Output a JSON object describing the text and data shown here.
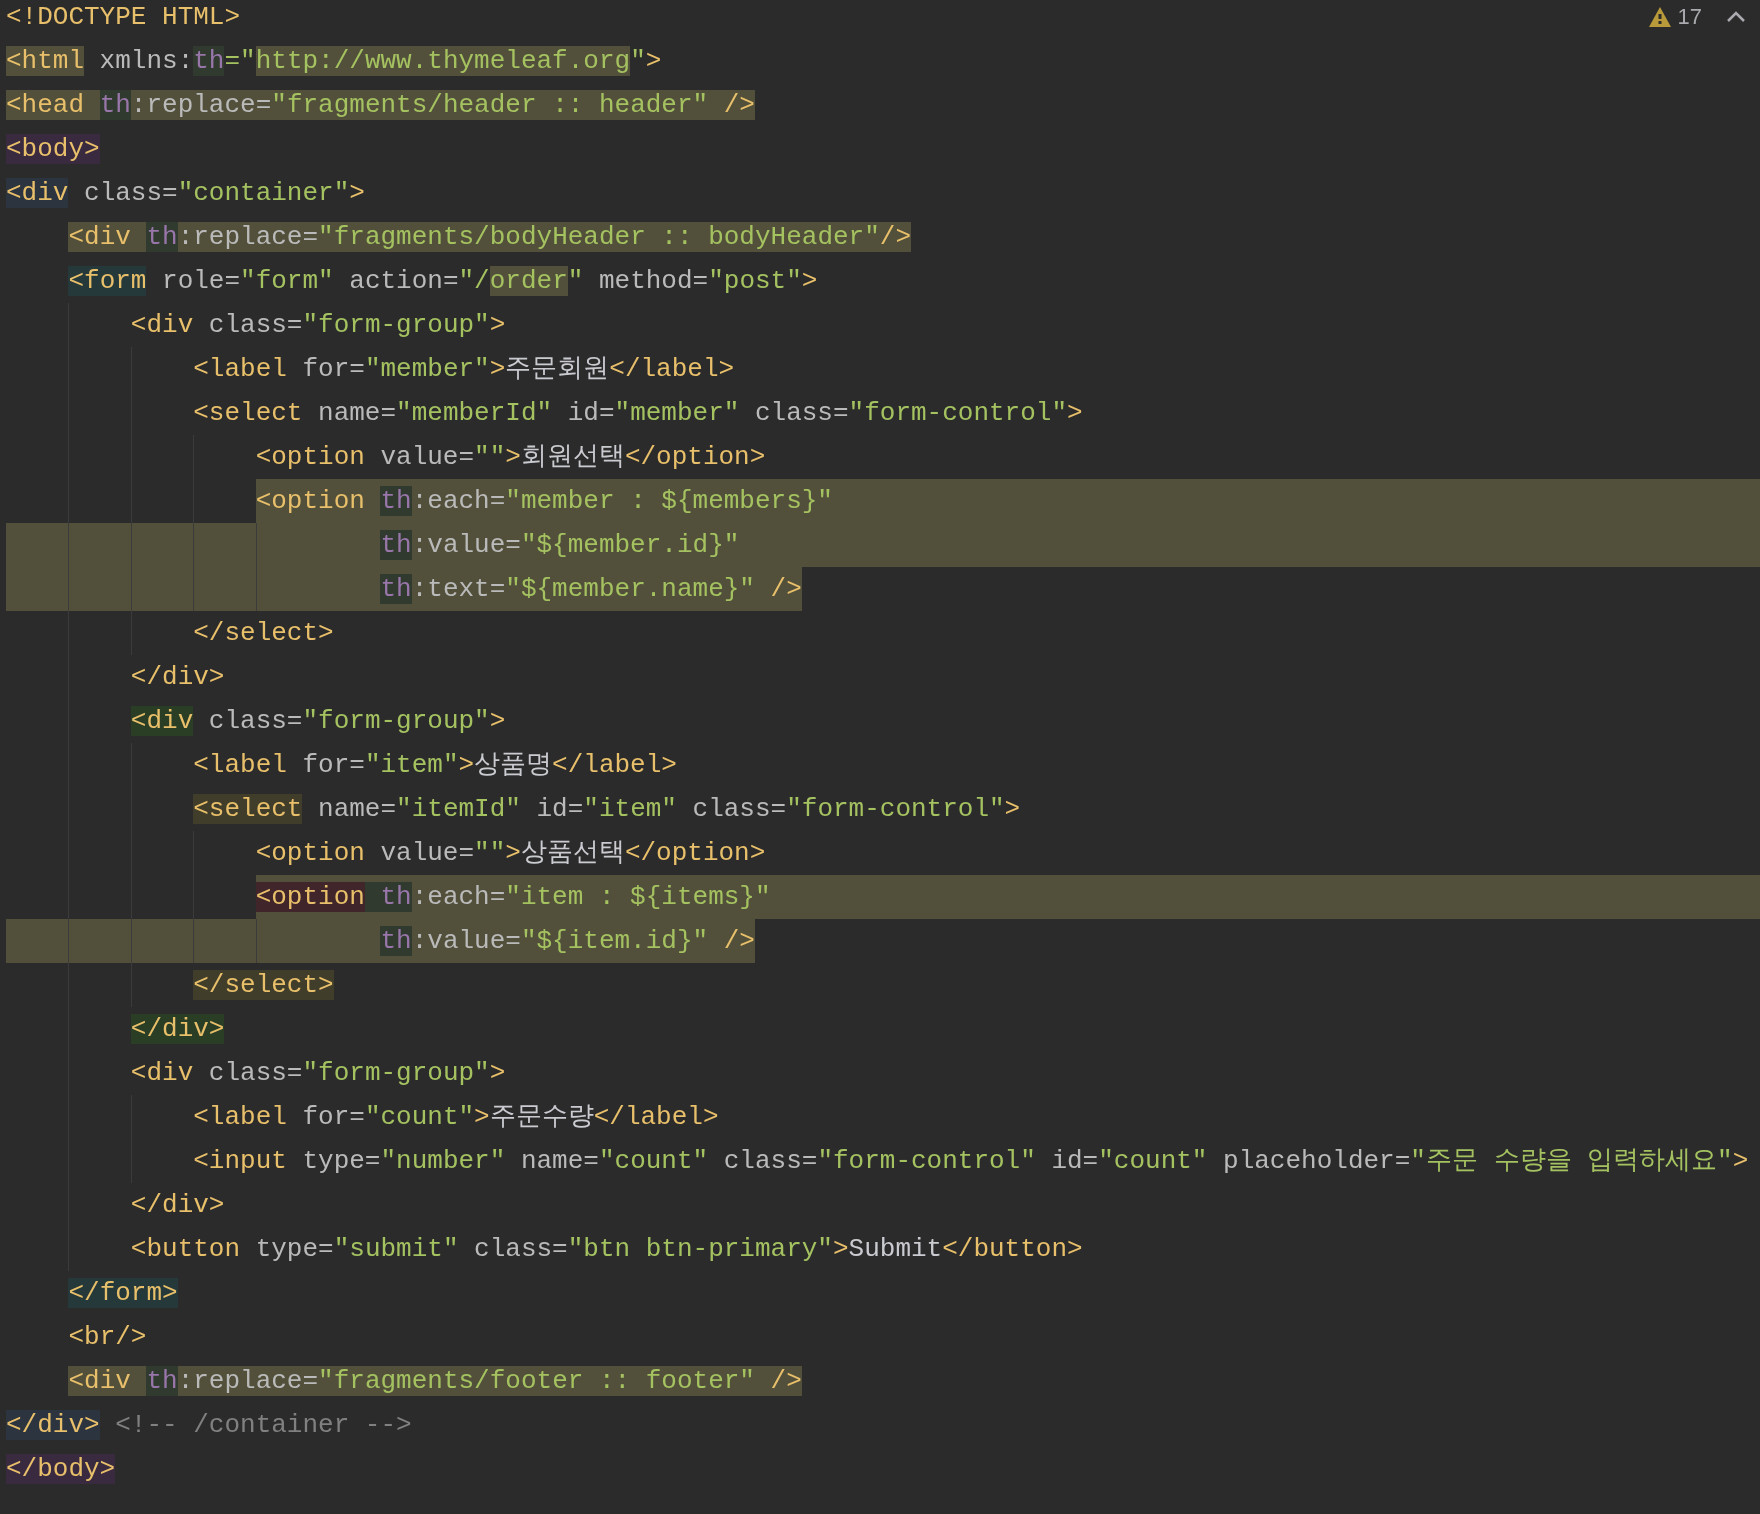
{
  "inspection": {
    "count": "17"
  },
  "lines": [
    {
      "kind": "plain",
      "tokens": [
        {
          "text": "<!DOCTYPE HTML>",
          "kind": "tag"
        }
      ]
    },
    {
      "kind": "plain",
      "tokens": [
        {
          "text": "<html",
          "kind": "tag",
          "color": "#52503a"
        },
        {
          "text": " xmlns:",
          "kind": "attr"
        },
        {
          "text": "th",
          "kind": "ns",
          "color": "#303a2e"
        },
        {
          "text": "=\"",
          "kind": "str"
        },
        {
          "text": "http://www.thymeleaf.org",
          "kind": "str",
          "color": "#52503a"
        },
        {
          "text": "\"",
          "kind": "str"
        },
        {
          "text": ">",
          "kind": "tag"
        }
      ]
    },
    {
      "kind": "plain",
      "tokens": [
        {
          "text": "<head ",
          "kind": "tag",
          "color": "#52503a"
        },
        {
          "text": "th",
          "kind": "ns",
          "color": "#303a2e"
        },
        {
          "text": ":replace=",
          "kind": "attr",
          "color": "#52503a"
        },
        {
          "text": "\"fragments/header :: header\"",
          "kind": "str",
          "color": "#52503a"
        },
        {
          "text": " />",
          "kind": "tag",
          "color": "#52503a"
        }
      ]
    },
    {
      "kind": "plain",
      "tokens": [
        {
          "text": "<body>",
          "kind": "tag",
          "color": "#3a2a40"
        }
      ]
    },
    {
      "kind": "plain",
      "tokens": [
        {
          "text": "<div",
          "kind": "tag",
          "color": "#2c3440"
        },
        {
          "text": " class=",
          "kind": "attr"
        },
        {
          "text": "\"container\"",
          "kind": "str"
        },
        {
          "text": ">",
          "kind": "tag"
        }
      ]
    },
    {
      "kind": "plain",
      "tokens": [
        {
          "text": "    <div ",
          "kind": "tag",
          "color": "#52503a"
        },
        {
          "text": "th",
          "kind": "ns",
          "color": "#303a2e"
        },
        {
          "text": ":replace=",
          "kind": "attr",
          "color": "#52503a"
        },
        {
          "text": "\"fragments/bodyHeader :: bodyHeader\"",
          "kind": "str",
          "color": "#52503a"
        },
        {
          "text": "/>",
          "kind": "tag",
          "color": "#52503a"
        }
      ]
    },
    {
      "kind": "plain",
      "tokens": [
        {
          "text": "    <form",
          "kind": "tag",
          "color": "#25393a"
        },
        {
          "text": " role=",
          "kind": "attr"
        },
        {
          "text": "\"form\"",
          "kind": "str"
        },
        {
          "text": " action=",
          "kind": "attr"
        },
        {
          "text": "\"/",
          "kind": "str"
        },
        {
          "text": "order",
          "kind": "str",
          "color": "#52503a"
        },
        {
          "text": "\"",
          "kind": "str"
        },
        {
          "text": " method=",
          "kind": "attr"
        },
        {
          "text": "\"post\"",
          "kind": "str"
        },
        {
          "text": ">",
          "kind": "tag"
        }
      ]
    },
    {
      "kind": "plain",
      "tokens": [
        {
          "text": "        <div",
          "kind": "tag"
        },
        {
          "text": " class=",
          "kind": "attr"
        },
        {
          "text": "\"form-group\"",
          "kind": "str"
        },
        {
          "text": ">",
          "kind": "tag"
        }
      ]
    },
    {
      "kind": "plain",
      "tokens": [
        {
          "text": "            <label",
          "kind": "tag"
        },
        {
          "text": " for=",
          "kind": "attr"
        },
        {
          "text": "\"member\"",
          "kind": "str"
        },
        {
          "text": ">",
          "kind": "tag"
        },
        {
          "text": "주문회원",
          "kind": "text"
        },
        {
          "text": "</label>",
          "kind": "tag"
        }
      ]
    },
    {
      "kind": "plain",
      "tokens": [
        {
          "text": "            <select",
          "kind": "tag"
        },
        {
          "text": " name=",
          "kind": "attr"
        },
        {
          "text": "\"memberId\"",
          "kind": "str"
        },
        {
          "text": " id=",
          "kind": "attr"
        },
        {
          "text": "\"member\"",
          "kind": "str"
        },
        {
          "text": " class=",
          "kind": "attr"
        },
        {
          "text": "\"form-control\"",
          "kind": "str"
        },
        {
          "text": ">",
          "kind": "tag"
        }
      ]
    },
    {
      "kind": "plain",
      "tokens": [
        {
          "text": "                <option",
          "kind": "tag"
        },
        {
          "text": " value=",
          "kind": "attr"
        },
        {
          "text": "\"\"",
          "kind": "str"
        },
        {
          "text": ">",
          "kind": "tag"
        },
        {
          "text": "회원선택",
          "kind": "text"
        },
        {
          "text": "</option>",
          "kind": "tag"
        }
      ]
    },
    {
      "kind": "rest",
      "tokens": [
        {
          "text": "                <option ",
          "kind": "tag"
        },
        {
          "text": "th",
          "kind": "ns",
          "color": "#303a2e"
        },
        {
          "text": ":each=",
          "kind": "attr"
        },
        {
          "text": "\"member : ${members}\"",
          "kind": "str"
        }
      ]
    },
    {
      "kind": "full",
      "tokens": [
        {
          "text": "                        th",
          "kind": "ns",
          "color": "#303a2e"
        },
        {
          "text": ":value=",
          "kind": "attr"
        },
        {
          "text": "\"${member.id}\"",
          "kind": "str"
        }
      ]
    },
    {
      "kind": "upto",
      "tokens": [
        {
          "text": "                        th",
          "kind": "ns",
          "color": "#303a2e"
        },
        {
          "text": ":text=",
          "kind": "attr"
        },
        {
          "text": "\"${member.name}\"",
          "kind": "str"
        },
        {
          "text": " />",
          "kind": "tag"
        }
      ]
    },
    {
      "kind": "plain",
      "tokens": [
        {
          "text": "            </select>",
          "kind": "tag"
        }
      ]
    },
    {
      "kind": "plain",
      "tokens": [
        {
          "text": "        </div>",
          "kind": "tag"
        }
      ]
    },
    {
      "kind": "plain",
      "tokens": [
        {
          "text": "        <div",
          "kind": "tag",
          "color": "#2a3d25"
        },
        {
          "text": " class=",
          "kind": "attr"
        },
        {
          "text": "\"form-group\"",
          "kind": "str"
        },
        {
          "text": ">",
          "kind": "tag"
        }
      ]
    },
    {
      "kind": "plain",
      "tokens": [
        {
          "text": "            <label",
          "kind": "tag"
        },
        {
          "text": " for=",
          "kind": "attr"
        },
        {
          "text": "\"item\"",
          "kind": "str"
        },
        {
          "text": ">",
          "kind": "tag"
        },
        {
          "text": "상품명",
          "kind": "text"
        },
        {
          "text": "</label>",
          "kind": "tag"
        }
      ]
    },
    {
      "kind": "plain",
      "tokens": [
        {
          "text": "            <select",
          "kind": "tag",
          "color": "#403d2a"
        },
        {
          "text": " name=",
          "kind": "attr"
        },
        {
          "text": "\"itemId\"",
          "kind": "str"
        },
        {
          "text": " id=",
          "kind": "attr"
        },
        {
          "text": "\"item\"",
          "kind": "str"
        },
        {
          "text": " class=",
          "kind": "attr"
        },
        {
          "text": "\"form-control\"",
          "kind": "str"
        },
        {
          "text": ">",
          "kind": "tag"
        }
      ]
    },
    {
      "kind": "plain",
      "tokens": [
        {
          "text": "                <option",
          "kind": "tag"
        },
        {
          "text": " value=",
          "kind": "attr"
        },
        {
          "text": "\"\"",
          "kind": "str"
        },
        {
          "text": ">",
          "kind": "tag"
        },
        {
          "text": "상품선택",
          "kind": "text"
        },
        {
          "text": "</option>",
          "kind": "tag"
        }
      ]
    },
    {
      "kind": "rest",
      "tokens": [
        {
          "text": "                <option",
          "kind": "tag",
          "color": "#40262a"
        },
        {
          "text": " th",
          "kind": "ns",
          "color": "#303a2e"
        },
        {
          "text": ":each=",
          "kind": "attr"
        },
        {
          "text": "\"item : ${items}\"",
          "kind": "str"
        }
      ]
    },
    {
      "kind": "upto",
      "tokens": [
        {
          "text": "                        th",
          "kind": "ns",
          "color": "#303a2e"
        },
        {
          "text": ":value=",
          "kind": "attr"
        },
        {
          "text": "\"${item.id}\"",
          "kind": "str"
        },
        {
          "text": " />",
          "kind": "tag"
        }
      ]
    },
    {
      "kind": "plain",
      "tokens": [
        {
          "text": "            </select>",
          "kind": "tag",
          "color": "#403d2a"
        }
      ]
    },
    {
      "kind": "plain",
      "tokens": [
        {
          "text": "        </div>",
          "kind": "tag",
          "color": "#2a3d25"
        }
      ]
    },
    {
      "kind": "plain",
      "tokens": [
        {
          "text": "        <div",
          "kind": "tag"
        },
        {
          "text": " class=",
          "kind": "attr"
        },
        {
          "text": "\"form-group\"",
          "kind": "str"
        },
        {
          "text": ">",
          "kind": "tag"
        }
      ]
    },
    {
      "kind": "plain",
      "tokens": [
        {
          "text": "            <label",
          "kind": "tag"
        },
        {
          "text": " for=",
          "kind": "attr"
        },
        {
          "text": "\"count\"",
          "kind": "str"
        },
        {
          "text": ">",
          "kind": "tag"
        },
        {
          "text": "주문수량",
          "kind": "text"
        },
        {
          "text": "</label>",
          "kind": "tag"
        }
      ]
    },
    {
      "kind": "plain",
      "tokens": [
        {
          "text": "            <input",
          "kind": "tag"
        },
        {
          "text": " type=",
          "kind": "attr"
        },
        {
          "text": "\"number\"",
          "kind": "str"
        },
        {
          "text": " name=",
          "kind": "attr"
        },
        {
          "text": "\"count\"",
          "kind": "str"
        },
        {
          "text": " class=",
          "kind": "attr"
        },
        {
          "text": "\"form-control\"",
          "kind": "str"
        },
        {
          "text": " id=",
          "kind": "attr"
        },
        {
          "text": "\"count\"",
          "kind": "str"
        },
        {
          "text": " placeholder=",
          "kind": "attr"
        },
        {
          "text": "\"주문 수량을 입력하세요\"",
          "kind": "str"
        },
        {
          "text": ">",
          "kind": "tag"
        }
      ]
    },
    {
      "kind": "plain",
      "tokens": [
        {
          "text": "        </div>",
          "kind": "tag"
        }
      ]
    },
    {
      "kind": "plain",
      "tokens": [
        {
          "text": "        <button",
          "kind": "tag"
        },
        {
          "text": " type=",
          "kind": "attr"
        },
        {
          "text": "\"submit\"",
          "kind": "str"
        },
        {
          "text": " class=",
          "kind": "attr"
        },
        {
          "text": "\"btn btn-primary\"",
          "kind": "str"
        },
        {
          "text": ">",
          "kind": "tag"
        },
        {
          "text": "Submit",
          "kind": "text"
        },
        {
          "text": "</button>",
          "kind": "tag"
        }
      ]
    },
    {
      "kind": "plain",
      "tokens": [
        {
          "text": "    </form>",
          "kind": "tag",
          "color": "#25393a"
        }
      ]
    },
    {
      "kind": "plain",
      "tokens": [
        {
          "text": "    <br/>",
          "kind": "tag"
        }
      ]
    },
    {
      "kind": "plain",
      "tokens": [
        {
          "text": "    <div ",
          "kind": "tag",
          "color": "#52503a"
        },
        {
          "text": "th",
          "kind": "ns",
          "color": "#303a2e"
        },
        {
          "text": ":replace=",
          "kind": "attr",
          "color": "#52503a"
        },
        {
          "text": "\"fragments/footer :: footer\"",
          "kind": "str",
          "color": "#52503a"
        },
        {
          "text": " />",
          "kind": "tag",
          "color": "#52503a"
        }
      ]
    },
    {
      "kind": "plain",
      "tokens": [
        {
          "text": "</div>",
          "kind": "tag",
          "color": "#2c3440"
        },
        {
          "text": " <!-- /container -->",
          "kind": "comment"
        }
      ]
    },
    {
      "kind": "plain",
      "tokens": [
        {
          "text": "</body>",
          "kind": "tag",
          "color": "#3a2a40"
        }
      ]
    }
  ]
}
